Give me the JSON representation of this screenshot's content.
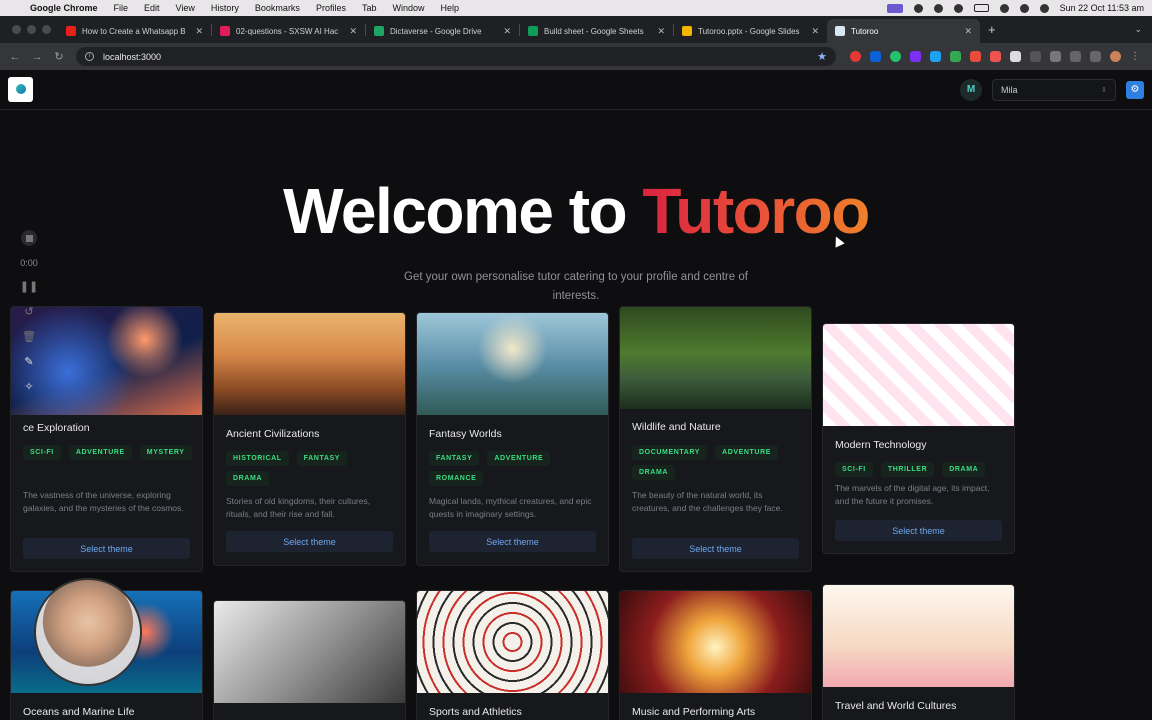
{
  "menubar": {
    "app": "Google Chrome",
    "items": [
      "File",
      "Edit",
      "View",
      "History",
      "Bookmarks",
      "Profiles",
      "Tab",
      "Window",
      "Help"
    ],
    "clock": "Sun 22 Oct  11:53 am"
  },
  "tabs": [
    {
      "title": "How to Create a Whatsapp B",
      "icon": "youtube-icon",
      "color": "#e62117"
    },
    {
      "title": "02-questions - SXSW AI Hac",
      "icon": "slack-icon",
      "color": "#e01e5a"
    },
    {
      "title": "Dictaverse - Google Drive",
      "icon": "drive-icon",
      "color": "#1fa463"
    },
    {
      "title": "Build sheet - Google Sheets",
      "icon": "sheets-icon",
      "color": "#0f9d58"
    },
    {
      "title": "Tutoroo.pptx - Google Slides",
      "icon": "slides-icon",
      "color": "#f4b400"
    },
    {
      "title": "Tutoroo",
      "icon": "tutoroo-icon",
      "color": "#d9e7f2",
      "active": true
    }
  ],
  "address": {
    "url": "localhost:3000"
  },
  "header": {
    "avatar_initial": "M",
    "user_select": "Mila"
  },
  "hero": {
    "title_prefix": "Welcome to ",
    "title_brand": "Tutoroo",
    "subtitle": "Get your own personalise tutor catering to your profile and centre of interests."
  },
  "recorder": {
    "time": "0:00"
  },
  "themes": [
    {
      "title": "Space Exploration",
      "display_title": "ce Exploration",
      "tags": [
        "SCI-FI",
        "ADVENTURE",
        "MYSTERY"
      ],
      "description": "The vastness of the universe, exploring galaxies, and the mysteries of the cosmos.",
      "button": "Select theme"
    },
    {
      "title": "Ancient Civilizations",
      "tags": [
        "HISTORICAL",
        "FANTASY",
        "DRAMA"
      ],
      "description": "Stories of old kingdoms, their cultures, rituals, and their rise and fall.",
      "button": "Select theme"
    },
    {
      "title": "Fantasy Worlds",
      "tags": [
        "FANTASY",
        "ADVENTURE",
        "ROMANCE"
      ],
      "description": "Magical lands, mythical creatures, and epic quests in imaginary settings.",
      "button": "Select theme"
    },
    {
      "title": "Wildlife and Nature",
      "tags": [
        "DOCUMENTARY",
        "ADVENTURE",
        "DRAMA"
      ],
      "description": "The beauty of the natural world, its creatures, and the challenges they face.",
      "button": "Select theme"
    },
    {
      "title": "Modern Technology",
      "tags": [
        "SCI-FI",
        "THRILLER",
        "DRAMA"
      ],
      "description": "The marvels of the digital age, its impact, and the future it promises.",
      "button": "Select theme"
    },
    {
      "title": "Oceans and Marine Life"
    },
    {
      "title": ""
    },
    {
      "title": "Sports and Athletics"
    },
    {
      "title": "Music and Performing Arts"
    },
    {
      "title": "Travel and World Cultures"
    }
  ]
}
